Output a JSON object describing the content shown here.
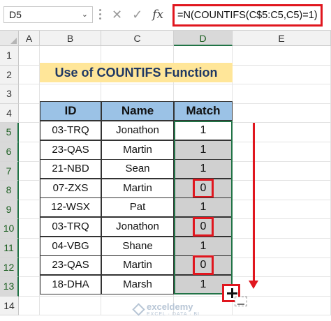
{
  "name_box": "D5",
  "formula_bar": {
    "cancel_icon": "x-icon",
    "enter_icon": "check-icon",
    "fx_label": "fx",
    "formula": "=N(COUNTIFS(C$5:C5,C5)=1)"
  },
  "columns": [
    "A",
    "B",
    "C",
    "D",
    "E"
  ],
  "rows": [
    "1",
    "2",
    "3",
    "4",
    "5",
    "6",
    "7",
    "8",
    "9",
    "10",
    "11",
    "12",
    "13",
    "14"
  ],
  "title": "Use of COUNTIFS Function",
  "table": {
    "headers": [
      "ID",
      "Name",
      "Match"
    ],
    "rows": [
      {
        "id": "03-TRQ",
        "name": "Jonathon",
        "match": "1"
      },
      {
        "id": "23-QAS",
        "name": "Martin",
        "match": "1"
      },
      {
        "id": "21-NBD",
        "name": "Sean",
        "match": "1"
      },
      {
        "id": "07-ZXS",
        "name": "Martin",
        "match": "0"
      },
      {
        "id": "12-WSX",
        "name": "Pat",
        "match": "1"
      },
      {
        "id": "03-TRQ",
        "name": "Jonathon",
        "match": "0"
      },
      {
        "id": "04-VBG",
        "name": "Shane",
        "match": "1"
      },
      {
        "id": "23-QAS",
        "name": "Martin",
        "match": "0"
      },
      {
        "id": "18-DHA",
        "name": "Marsh",
        "match": "1"
      }
    ]
  },
  "watermark": {
    "brand": "exceldemy",
    "tagline": "EXCEL · DATA · BI"
  },
  "colors": {
    "highlight": "#e0161e",
    "header_fill": "#9bc2e6",
    "title_fill": "#ffe699",
    "selection": "#217346"
  }
}
